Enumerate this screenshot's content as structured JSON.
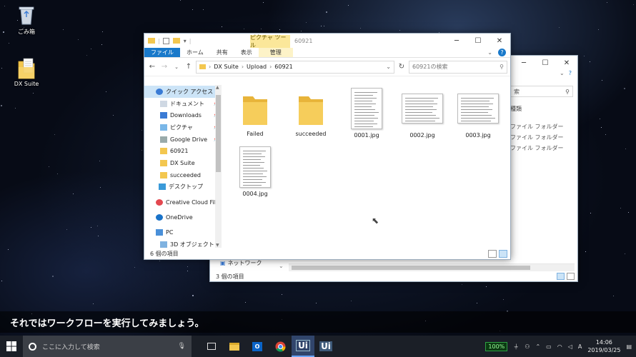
{
  "desktop": {
    "icons": [
      {
        "label": "ごみ箱",
        "icon": "recycle-bin-icon"
      },
      {
        "label": "DX Suite",
        "icon": "dx-suite-icon"
      }
    ]
  },
  "back_window": {
    "search_fragment": "索",
    "column_header": "種類",
    "rows": [
      "ファイル フォルダー",
      "ファイル フォルダー",
      "ファイル フォルダー"
    ],
    "nav_partial": "ネットワーク",
    "status": "3 個の項目"
  },
  "front_window": {
    "title": "60921",
    "contextual_tab": "ピクチャ ツール",
    "ribbon_tabs": [
      "ファイル",
      "ホーム",
      "共有",
      "表示",
      "管理"
    ],
    "breadcrumb": [
      "DX Suite",
      "Upload",
      "60921"
    ],
    "search_placeholder": "60921の検索",
    "nav_items": [
      {
        "label": "クイック アクセス",
        "icon": "star-icon",
        "pinned": false
      },
      {
        "label": "ドキュメント",
        "icon": "documents-icon",
        "pinned": true
      },
      {
        "label": "Downloads",
        "icon": "downloads-icon",
        "pinned": true
      },
      {
        "label": "ピクチャ",
        "icon": "pictures-icon",
        "pinned": true
      },
      {
        "label": "Google Drive",
        "icon": "drive-icon",
        "pinned": true
      },
      {
        "label": "60921",
        "icon": "folder-icon",
        "pinned": false
      },
      {
        "label": "DX Suite",
        "icon": "folder-icon",
        "pinned": false
      },
      {
        "label": "succeeded",
        "icon": "folder-icon",
        "pinned": false
      },
      {
        "label": "デスクトップ",
        "icon": "desktop-icon",
        "pinned": false
      },
      {
        "label": "Creative Cloud File",
        "icon": "creative-cloud-icon",
        "pinned": false
      },
      {
        "label": "OneDrive",
        "icon": "onedrive-icon",
        "pinned": false
      },
      {
        "label": "PC",
        "icon": "pc-icon",
        "pinned": false
      },
      {
        "label": "3D オブジェクト",
        "icon": "3d-objects-icon",
        "pinned": false
      }
    ],
    "files": [
      {
        "name": "Failed",
        "kind": "folder"
      },
      {
        "name": "succeeded",
        "kind": "folder"
      },
      {
        "name": "0001.jpg",
        "kind": "portrait"
      },
      {
        "name": "0002.jpg",
        "kind": "landscape"
      },
      {
        "name": "0003.jpg",
        "kind": "landscape"
      },
      {
        "name": "0004.jpg",
        "kind": "portrait"
      }
    ],
    "status": "6 個の項目"
  },
  "subtitle": "それではワークフローを実行してみましょう。",
  "taskbar": {
    "search_placeholder": "ここに入力して検索",
    "apps": [
      "task-view-icon",
      "file-explorer-icon",
      "outlook-icon",
      "chrome-icon",
      "uipath-studio-icon",
      "uipath-robot-icon"
    ],
    "uipath_label": "Ui",
    "battery": "100%",
    "ime": "A",
    "time": "14:06",
    "date": "2019/03/25"
  },
  "colors": {
    "accent": "#1979ca",
    "folder": "#f3c74f",
    "selected": "#cce4f7",
    "contextual_tab": "#fbe79a"
  }
}
